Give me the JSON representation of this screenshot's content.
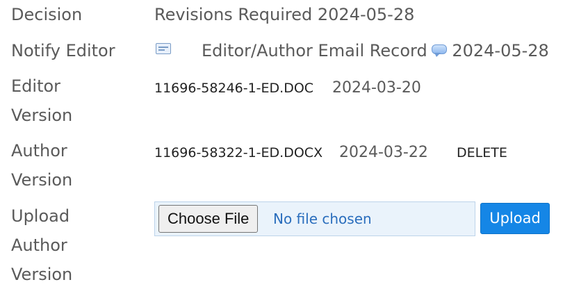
{
  "rows": {
    "decision": {
      "label": "Decision",
      "value": "Revisions Required",
      "date": "2024-05-28"
    },
    "notify_editor": {
      "label": "Notify Editor",
      "envelope_icon": "envelope-icon",
      "link": "Editor/Author Email Record",
      "comment_icon": "speech-bubble-icon",
      "date": "2024-05-28"
    },
    "editor_version": {
      "label_line1": "Editor",
      "label_line2": "Version",
      "file": "11696-58246-1-ED.DOC",
      "date": "2024-03-20"
    },
    "author_version": {
      "label_line1": "Author",
      "label_line2": "Version",
      "file": "11696-58322-1-ED.DOCX",
      "date": "2024-03-22",
      "delete": "DELETE"
    },
    "upload_author_version": {
      "label_line1": "Upload",
      "label_line2": "Author",
      "label_line3": "Version",
      "choose_file": "Choose File",
      "no_file": "No file chosen",
      "upload": "Upload"
    }
  }
}
